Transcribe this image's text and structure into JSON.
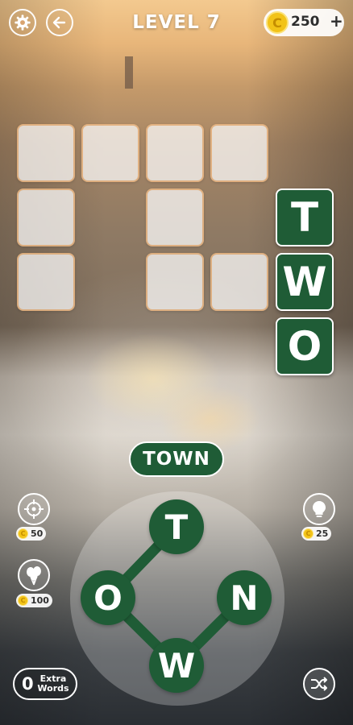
{
  "header": {
    "level_title": "LEVEL 7",
    "coin_symbol": "C",
    "coins": "250",
    "add_coins": "+"
  },
  "grid": {
    "rows": 3,
    "cols": 5,
    "word_across": "",
    "placed_word": "TWO",
    "letters": {
      "row0_col4": "T",
      "row1_col4": "W",
      "row2_col4": "O"
    },
    "colors": {
      "filled": "#1f5c36",
      "empty": "#ffffff"
    }
  },
  "current_word": "TOWN",
  "wheel": {
    "letters": [
      "T",
      "O",
      "N",
      "W"
    ],
    "selected_path": [
      "T",
      "O",
      "W",
      "N"
    ]
  },
  "tools": {
    "target": {
      "icon": "crosshair-icon",
      "cost": "50"
    },
    "hint": {
      "icon": "lightbulb-icon",
      "cost": "25"
    },
    "balloons": {
      "icon": "balloons-icon",
      "cost": "100"
    },
    "shuffle": {
      "icon": "shuffle-icon"
    },
    "extra_words": {
      "count": "0",
      "label": "Extra Words"
    },
    "coin_symbol": "C"
  }
}
